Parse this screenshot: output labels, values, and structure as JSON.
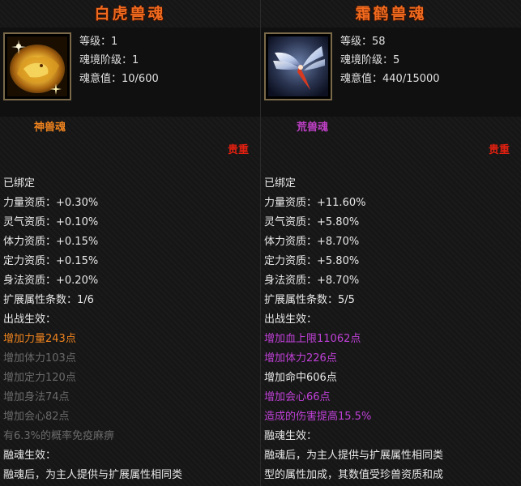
{
  "left": {
    "title": "白虎兽魂",
    "stats": [
      {
        "label": "等级：1"
      },
      {
        "label": "魂境阶级：1"
      },
      {
        "label": "魂意值：10/600"
      }
    ],
    "type_label": "神兽魂",
    "rarity": "贵重",
    "lines": [
      {
        "text": "已绑定",
        "color": "white"
      },
      {
        "text": "力量资质：+0.30%",
        "color": "white"
      },
      {
        "text": "灵气资质：+0.10%",
        "color": "white"
      },
      {
        "text": "体力资质：+0.15%",
        "color": "white"
      },
      {
        "text": "定力资质：+0.15%",
        "color": "white"
      },
      {
        "text": "身法资质：+0.20%",
        "color": "white"
      },
      {
        "text": "扩展属性条数：1/6",
        "color": "white"
      },
      {
        "text": "出战生效：",
        "color": "white"
      },
      {
        "text": "增加力量243点",
        "color": "orange"
      },
      {
        "text": "增加体力103点",
        "color": "gray"
      },
      {
        "text": "增加定力120点",
        "color": "gray"
      },
      {
        "text": "增加身法74点",
        "color": "gray"
      },
      {
        "text": "增加会心82点",
        "color": "gray"
      },
      {
        "text": "有6.3%的概率免疫麻痹",
        "color": "gray"
      },
      {
        "text": "融魂生效：",
        "color": "white"
      },
      {
        "text": "融魂后，为主人提供与扩展属性相同类",
        "color": "white"
      }
    ]
  },
  "right": {
    "title": "霜鹤兽魂",
    "stats": [
      {
        "label": "等级：58"
      },
      {
        "label": "魂境阶级：5"
      },
      {
        "label": "魂意值：440/15000"
      }
    ],
    "type_label": "荒兽魂",
    "rarity": "贵重",
    "lines": [
      {
        "text": "已绑定",
        "color": "white"
      },
      {
        "text": "力量资质：+11.60%",
        "color": "white"
      },
      {
        "text": "灵气资质：+5.80%",
        "color": "white"
      },
      {
        "text": "体力资质：+8.70%",
        "color": "white"
      },
      {
        "text": "定力资质：+5.80%",
        "color": "white"
      },
      {
        "text": "身法资质：+8.70%",
        "color": "white"
      },
      {
        "text": "扩展属性条数：5/5",
        "color": "white"
      },
      {
        "text": "出战生效：",
        "color": "white"
      },
      {
        "text": "增加血上限11062点",
        "color": "purple"
      },
      {
        "text": "增加体力226点",
        "color": "purple"
      },
      {
        "text": "增加命中606点",
        "color": "white"
      },
      {
        "text": "增加会心66点",
        "color": "purple"
      },
      {
        "text": "造成的伤害提高15.5%",
        "color": "purple"
      },
      {
        "text": "融魂生效：",
        "color": "white"
      },
      {
        "text": "融魂后，为主人提供与扩展属性相同类",
        "color": "white"
      },
      {
        "text": "型的属性加成，其数值受珍兽资质和成",
        "color": "white"
      }
    ]
  },
  "colors": {
    "title": "#f06a1e",
    "orange": "#f0841e",
    "purple": "#c040d8",
    "gray": "#6a6a6a",
    "white": "#e8e8e8",
    "rarity": "#e02010"
  },
  "icons": {
    "left": "golden-tiger-spirit-icon",
    "right": "frost-crane-wing-icon"
  }
}
